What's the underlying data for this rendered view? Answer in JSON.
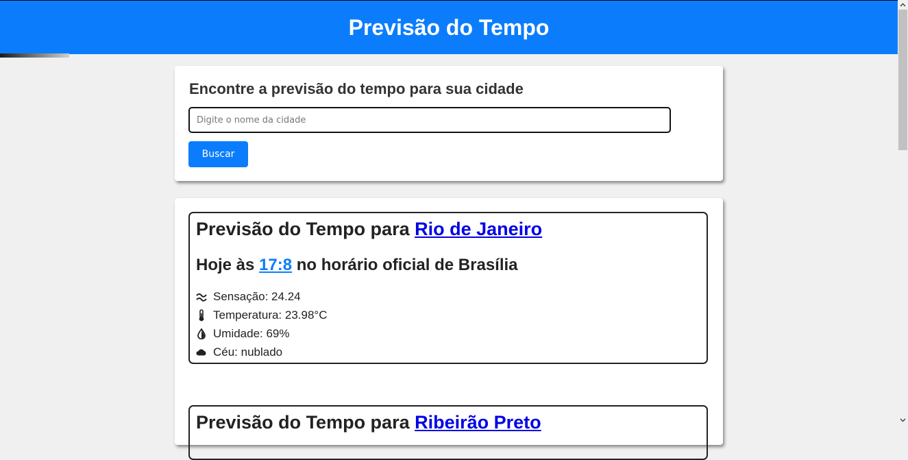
{
  "header": {
    "title": "Previsão do Tempo"
  },
  "search": {
    "heading": "Encontre a previsão do tempo para sua cidade",
    "placeholder": "Digite o nome da cidade",
    "button_label": "Buscar"
  },
  "forecasts": [
    {
      "title_prefix": "Previsão do Tempo para",
      "city": "Rio de Janeiro",
      "time_prefix": "Hoje às",
      "time": "17:8",
      "time_suffix": "no horário oficial de Brasília",
      "metrics": [
        {
          "icon": "wind-icon",
          "text": "Sensação: 24.24"
        },
        {
          "icon": "thermometer-icon",
          "text": "Temperatura: 23.98°C"
        },
        {
          "icon": "humidity-icon",
          "text": "Umidade: 69%"
        },
        {
          "icon": "cloud-icon",
          "text": "Céu: nublado"
        }
      ]
    },
    {
      "title_prefix": "Previsão do Tempo para",
      "city": "Ribeirão Preto"
    }
  ],
  "colors": {
    "header_bg": "#0b7dfc",
    "button_bg": "#0b7dfc",
    "link": "#0000e6"
  }
}
